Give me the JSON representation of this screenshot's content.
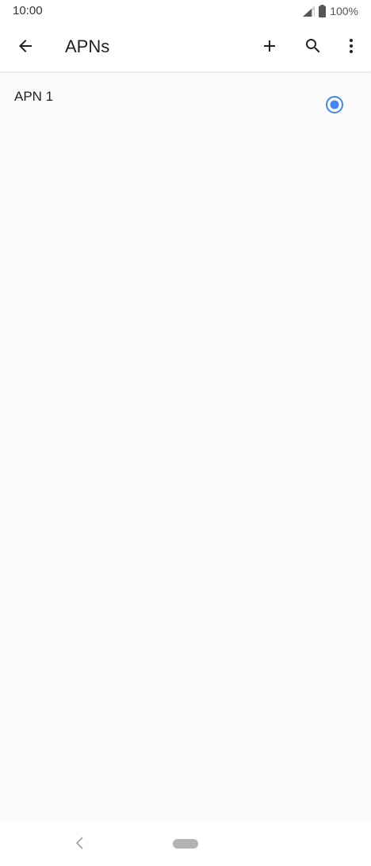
{
  "status_bar": {
    "time": "10:00",
    "battery_percent": "100%",
    "icons": [
      "signal-icon",
      "battery-icon"
    ]
  },
  "app_bar": {
    "title": "APNs",
    "actions": [
      "back-arrow-icon",
      "add-icon",
      "search-icon",
      "more-vert-icon"
    ]
  },
  "apn_list": {
    "items": [
      {
        "name": "APN 1",
        "selected": true
      }
    ]
  },
  "nav_bar": {
    "icons": [
      "nav-back-icon",
      "nav-home-pill"
    ]
  },
  "colors": {
    "accent": "#4285f4",
    "background": "#fafafa",
    "bar_background": "#ffffff"
  }
}
